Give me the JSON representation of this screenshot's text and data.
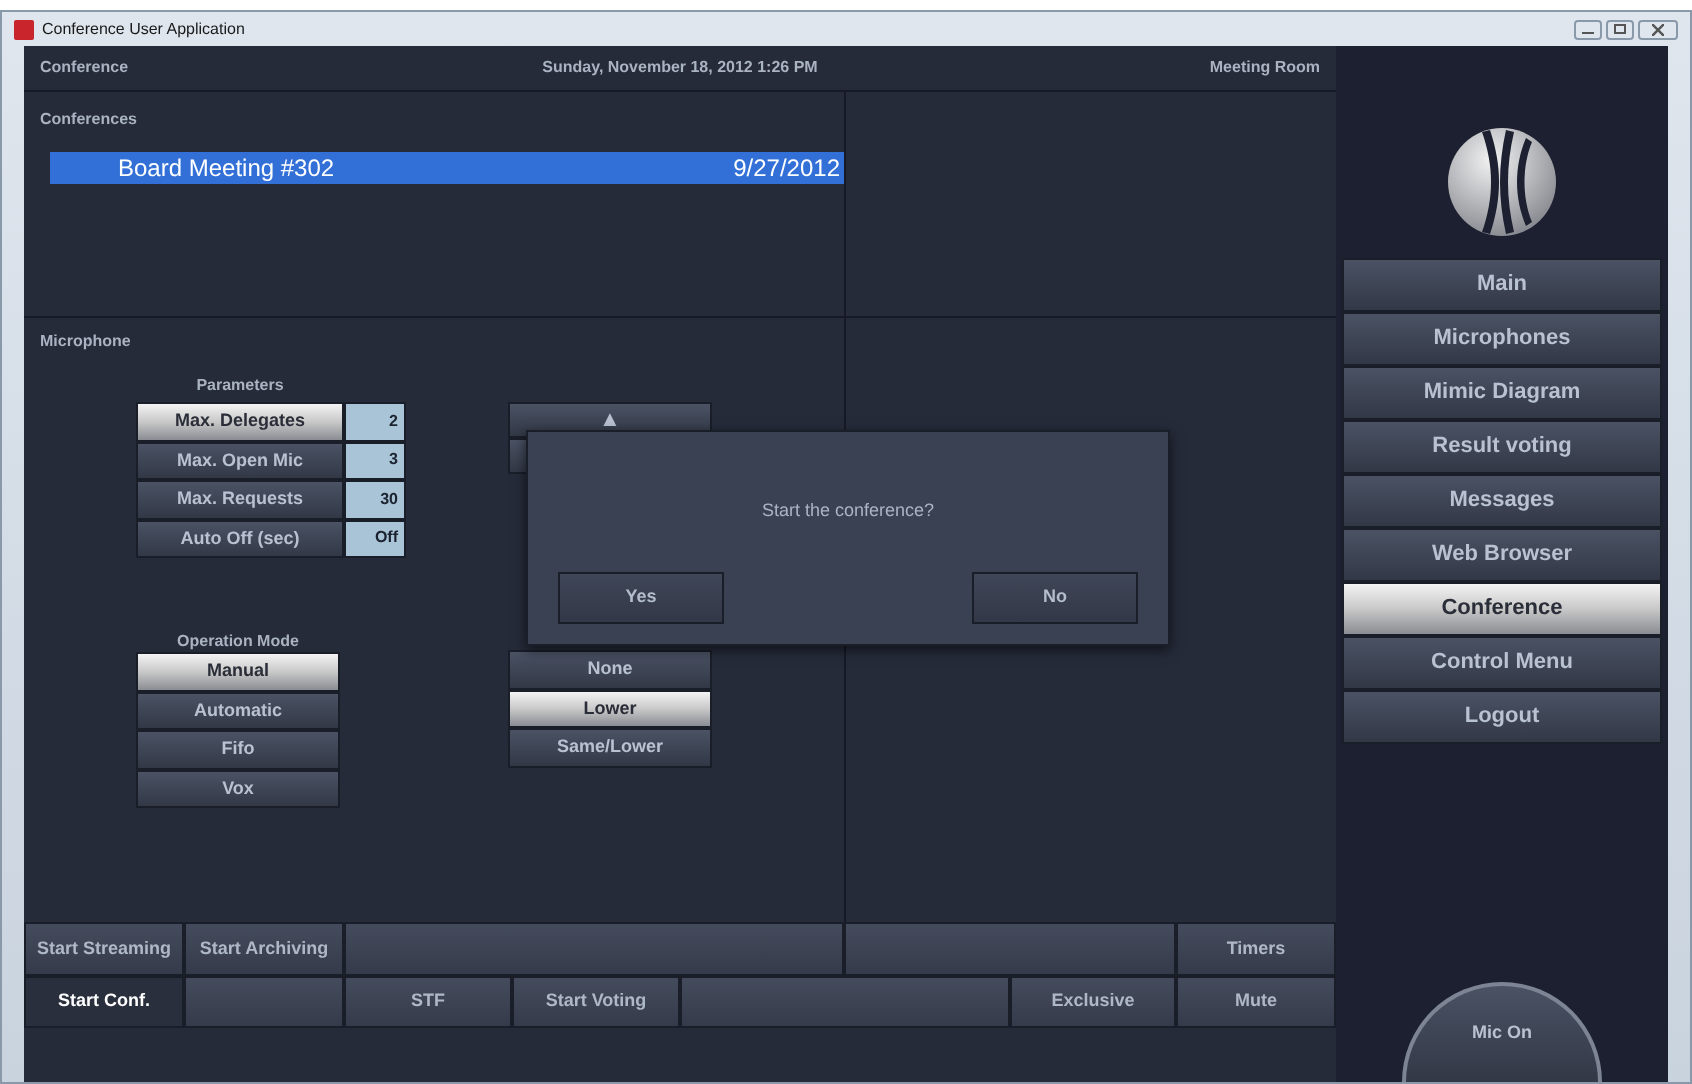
{
  "window": {
    "title": "Conference User Application"
  },
  "header": {
    "left": "Conference",
    "date": "Sunday, November 18, 2012 1:26 PM",
    "right": "Meeting Room"
  },
  "conferences": {
    "title": "Conferences",
    "rows": [
      {
        "name": "Board Meeting #302",
        "date": "9/27/2012",
        "selected": true
      }
    ]
  },
  "microphone": {
    "title": "Microphone",
    "parameters": {
      "title": "Parameters",
      "rows": [
        {
          "label": "Max. Delegates",
          "value": "2",
          "selected": true
        },
        {
          "label": "Max. Open Mic",
          "value": "3",
          "selected": false
        },
        {
          "label": "Max. Requests",
          "value": "30",
          "selected": false
        },
        {
          "label": "Auto Off (sec)",
          "value": "Off",
          "selected": false
        }
      ]
    },
    "operation_mode": {
      "title": "Operation Mode",
      "options": [
        {
          "label": "Manual",
          "selected": true
        },
        {
          "label": "Automatic",
          "selected": false
        },
        {
          "label": "Fifo",
          "selected": false
        },
        {
          "label": "Vox",
          "selected": false
        }
      ]
    },
    "scroll_up": {
      "label": "▲"
    },
    "priority": [
      {
        "label": "None",
        "selected": false
      },
      {
        "label": "Lower",
        "selected": true
      },
      {
        "label": "Same/Lower",
        "selected": false
      }
    ]
  },
  "dialog": {
    "message": "Start the conference?",
    "buttons": [
      "Yes",
      "No"
    ]
  },
  "nav": [
    {
      "label": "Main",
      "selected": false
    },
    {
      "label": "Microphones",
      "selected": false
    },
    {
      "label": "Mimic Diagram",
      "selected": false
    },
    {
      "label": "Result voting",
      "selected": false
    },
    {
      "label": "Messages",
      "selected": false
    },
    {
      "label": "Web Browser",
      "selected": false
    },
    {
      "label": "Conference",
      "selected": true
    },
    {
      "label": "Control Menu",
      "selected": false
    },
    {
      "label": "Logout",
      "selected": false
    }
  ],
  "toolbar": [
    [
      {
        "kind": "button",
        "label": "Start Streaming",
        "selected": false
      },
      {
        "kind": "button",
        "label": "Start Archiving",
        "selected": false
      },
      {
        "kind": "blank"
      },
      {
        "kind": "blank"
      },
      {
        "kind": "button",
        "label": "Timers",
        "selected": false
      }
    ],
    [
      {
        "kind": "button",
        "label": "Start Conf.",
        "selected": true
      },
      {
        "kind": "blank"
      },
      {
        "kind": "button",
        "label": "STF",
        "selected": false
      },
      {
        "kind": "button",
        "label": "Start Voting",
        "selected": false
      },
      {
        "kind": "blank"
      },
      {
        "kind": "button",
        "label": "Exclusive",
        "selected": false
      },
      {
        "kind": "button",
        "label": "Mute",
        "selected": false
      }
    ]
  ],
  "mic_button": {
    "label": "Mic On"
  }
}
